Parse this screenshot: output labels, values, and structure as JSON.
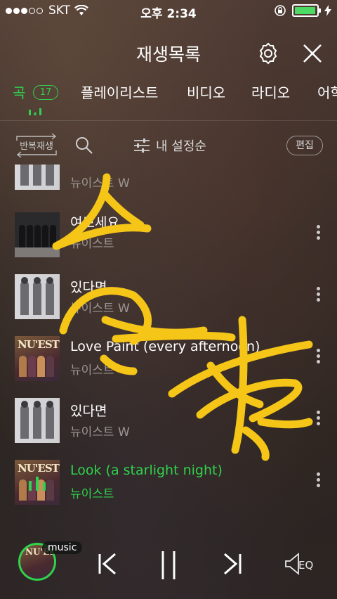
{
  "status_bar": {
    "carrier": "SKT",
    "time": "오후 2:34"
  },
  "header": {
    "title": "재생목록"
  },
  "tabs": [
    {
      "label": "곡",
      "count": "17"
    },
    {
      "label": "플레이리스트"
    },
    {
      "label": "비디오"
    },
    {
      "label": "라디오"
    },
    {
      "label": "어학"
    }
  ],
  "toolbar": {
    "repeat_label": "반복재생",
    "sort_label": "내 설정순",
    "edit_label": "편집"
  },
  "songs": [
    {
      "title": "",
      "artist": "뉴이스트 W"
    },
    {
      "title": "여보세요",
      "artist": "뉴이스트"
    },
    {
      "title": "있다면",
      "artist": "뉴이스트 W"
    },
    {
      "title": "Love Paint (every afternoon)",
      "artist": "뉴이스트"
    },
    {
      "title": "있다면",
      "artist": "뉴이스트 W"
    },
    {
      "title": "Look (a starlight night)",
      "artist": "뉴이스트"
    }
  ],
  "album_logo_text": "NU'EST",
  "player": {
    "badge": "music",
    "eq_label": "EQ"
  },
  "colors": {
    "accent": "#2fd34c",
    "scribble": "#f5c518",
    "battery": "#4cd964"
  }
}
